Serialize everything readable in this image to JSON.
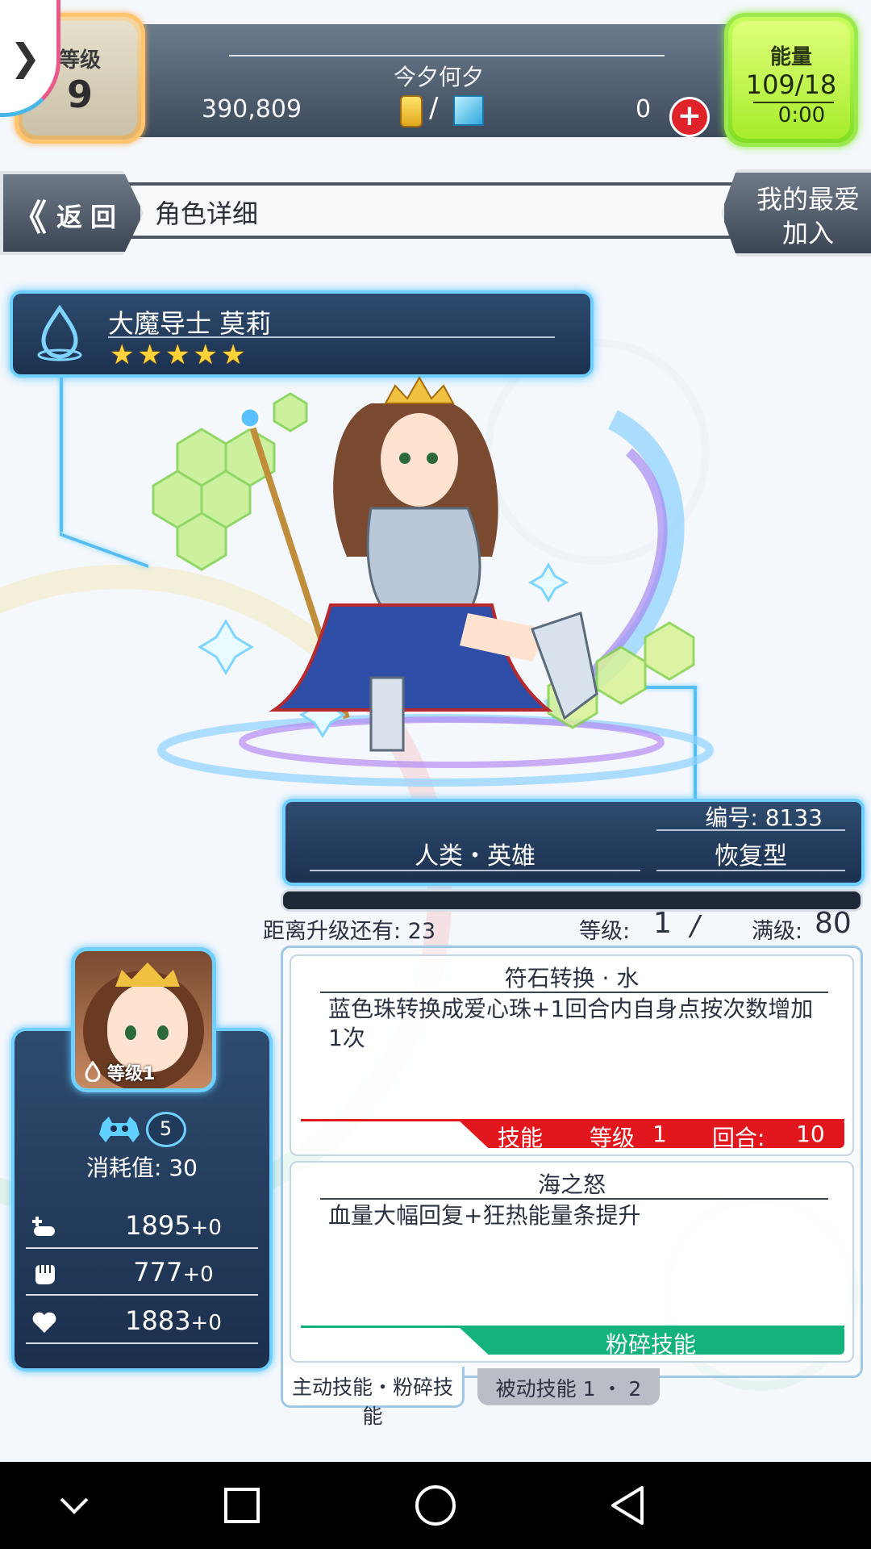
{
  "header": {
    "level_label": "等级",
    "level_value": "9",
    "player_name": "今夕何夕",
    "gold": "390,809",
    "currency_slash": "/",
    "gems": "0",
    "energy_label": "能量",
    "energy_value": "109/18",
    "energy_timer": "0:00"
  },
  "nav": {
    "back_chevron": "《",
    "back_label": "返回",
    "page_title": "角色详细",
    "favorite_line1": "我的最爱",
    "favorite_line2": "加入"
  },
  "character": {
    "element": "water",
    "name": "大魔导士 莫莉",
    "stars": "★★★★★",
    "rarity": 5,
    "id_text": "编号: 8133",
    "race": "人类・英雄",
    "type": "恢复型"
  },
  "experience": {
    "remaining_text": "距离升级还有: 23",
    "level_label": "等级:",
    "level_value": "1",
    "separator": "/",
    "max_label": "满级:",
    "max_value": "80",
    "progress": 0.0
  },
  "stats": {
    "portrait_level": "等级1",
    "cost_badge": "5",
    "cost_text": "消耗值: 30",
    "hp": "1895",
    "hp_bonus": "+0",
    "attack": "777",
    "attack_bonus": "+0",
    "recovery": "1883",
    "recovery_bonus": "+0"
  },
  "skills": {
    "active": {
      "title": "符石转换 · 水",
      "description": "蓝色珠转换成爱心珠+1回合内自身点按次数增加1次",
      "bar_label": "技能",
      "level_label": "等级",
      "level_value": "1",
      "turn_label": "回合:",
      "turn_value": "10"
    },
    "smash": {
      "title": "海之怒",
      "description": "血量大幅回复+狂热能量条提升",
      "bar_label": "粉碎技能"
    }
  },
  "tabs": {
    "active_tab": "主动技能・粉碎技能",
    "passive_tab": "被动技能 1 ・ 2"
  },
  "colors": {
    "frame_blue": "#6fd0ff",
    "panel_navy": "#1c3150",
    "energy_green": "#a7ec2c",
    "level_gold": "#e2b269",
    "skill_red": "#e2171d",
    "smash_green": "#14b37d",
    "star_yellow": "#ffd23a"
  },
  "icons": {
    "menu": "chevron-right-icon",
    "coin": "coin-icon",
    "gem": "gem-icon",
    "plus": "plus-icon",
    "element": "water-drop-icon",
    "cost": "monster-icon",
    "hp": "hp-icon",
    "attack": "fist-icon",
    "recovery": "heart-icon",
    "nav_back": "triangle-back-icon",
    "nav_home": "circle-home-icon",
    "nav_recent": "square-recent-icon",
    "nav_down": "chevron-down-icon"
  }
}
